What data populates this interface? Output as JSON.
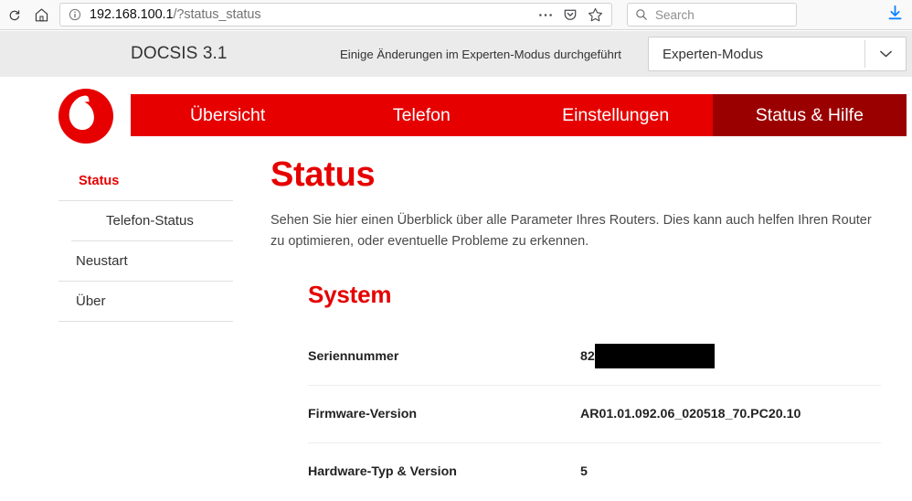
{
  "browser": {
    "reload_icon": "reload-icon",
    "home_icon": "home-icon",
    "identity_icon": "info-circle-icon",
    "url_host": "192.168.100.1",
    "url_path": "/?status_status",
    "page_actions_icon": "ellipsis-icon",
    "pocket_icon": "pocket-icon",
    "bookmark_icon": "star-icon",
    "search_icon": "search-icon",
    "search_placeholder": "Search",
    "search_value": "",
    "downloads_icon": "download-arrow-icon"
  },
  "router_header": {
    "docsis_label": "DOCSIS 3.1",
    "expert_notice": "Einige Änderungen im Experten-Modus durchgeführt",
    "mode_select_value": "Experten-Modus",
    "mode_select_arrow_icon": "chevron-down-icon"
  },
  "brand": {
    "logo_name": "vodafone-logo",
    "brand_color": "#e60000"
  },
  "nav": {
    "tabs": [
      {
        "label": "Übersicht",
        "active": false
      },
      {
        "label": "Telefon",
        "active": false
      },
      {
        "label": "Einstellungen",
        "active": false
      },
      {
        "label": "Status & Hilfe",
        "active": true
      }
    ],
    "active_color": "#9b0000",
    "base_color": "#e60000"
  },
  "sidebar": {
    "items": [
      {
        "label": "Status",
        "level": 0,
        "active": true
      },
      {
        "label": "Telefon-Status",
        "level": 1,
        "active": false
      },
      {
        "label": "Neustart",
        "level": 0,
        "active": false
      },
      {
        "label": "Über",
        "level": 0,
        "active": false
      }
    ]
  },
  "main": {
    "title": "Status",
    "intro": "Sehen Sie hier einen Überblick über alle Parameter Ihres Routers. Dies kann auch helfen Ihren Router zu optimieren, oder eventuelle Probleme zu erkennen.",
    "section_title": "System",
    "rows": [
      {
        "label": "Seriennummer",
        "value": "82",
        "redacted": true
      },
      {
        "label": "Firmware-Version",
        "value": "AR01.01.092.06_020518_70.PC20.10",
        "redacted": false
      },
      {
        "label": "Hardware-Typ & Version",
        "value": "5",
        "redacted": false
      }
    ]
  }
}
